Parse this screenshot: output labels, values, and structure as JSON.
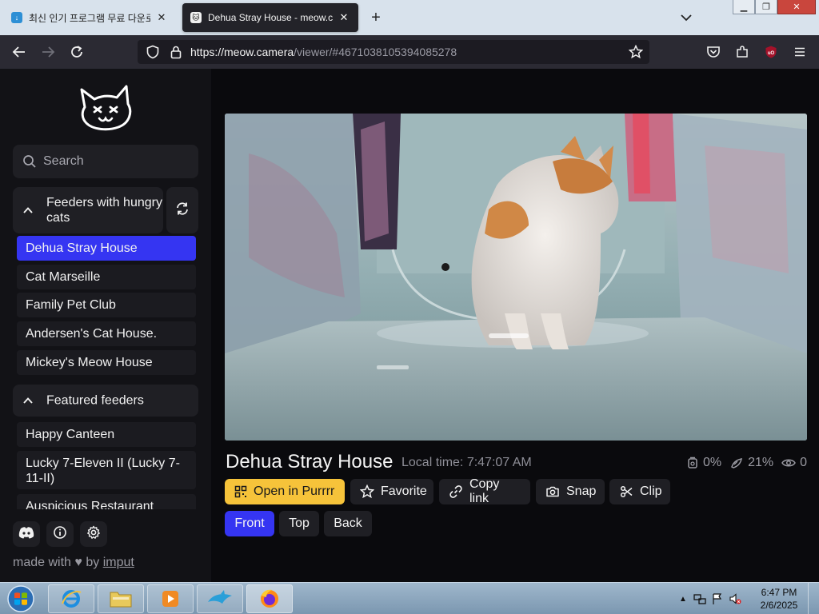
{
  "browser": {
    "tabs": [
      {
        "title": "최신 인기 프로그램 무료 다운로드",
        "active": false
      },
      {
        "title": "Dehua Stray House - meow.camera",
        "active": true
      }
    ],
    "url": {
      "host": "https://meow.camera",
      "path": "/viewer/#4671038105394085278"
    }
  },
  "sidebar": {
    "search": {
      "placeholder": "Search"
    },
    "sections": [
      {
        "title": "Feeders with hungry cats",
        "items": [
          {
            "label": "Dehua Stray House",
            "active": true
          },
          {
            "label": "Cat Marseille"
          },
          {
            "label": "Family Pet Club"
          },
          {
            "label": "Andersen's Cat House."
          },
          {
            "label": "Mickey's Meow House"
          }
        ]
      },
      {
        "title": "Featured feeders",
        "items": [
          {
            "label": "Happy Canteen"
          },
          {
            "label": "Lucky 7-Eleven II (Lucky 7-11-II)"
          },
          {
            "label": "Auspicious Restaurant"
          }
        ]
      }
    ],
    "footer": {
      "made_prefix": "made with",
      "made_by": "by",
      "author": "imput"
    }
  },
  "viewer": {
    "title": "Dehua Stray House",
    "local_time": "Local time: 7:47:07 AM",
    "stats": {
      "food": "0%",
      "pets": "21%",
      "viewers": "0"
    },
    "actions": {
      "open": "Open in Purrrr",
      "favorite": "Favorite",
      "copy": "Copy link",
      "snap": "Snap",
      "clip": "Clip"
    },
    "views": [
      "Front",
      "Top",
      "Back"
    ],
    "active_view": "Front"
  },
  "taskbar": {
    "time": "6:47 PM",
    "date": "2/6/2025"
  },
  "colors": {
    "accent": "#3535f2",
    "primary_button": "#f6c33a",
    "sidebar_bg": "#121216"
  }
}
